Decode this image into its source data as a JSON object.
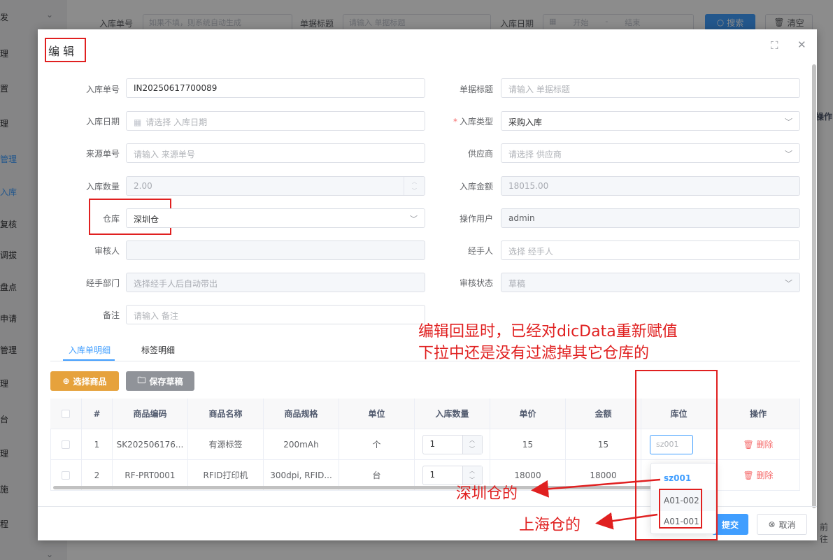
{
  "background": {
    "sidebar_items": [
      "发",
      "理",
      "置",
      "理",
      "管理",
      "入库",
      "复核",
      "调拔",
      "盘点",
      "申请",
      "管理",
      "理",
      "台",
      "理",
      "施",
      "程"
    ],
    "search_bar": {
      "label_no": "入库单号",
      "no_placeholder": "如果不填，则系统自动生成",
      "label_title": "单据标题",
      "title_placeholder": "请输入 单据标题",
      "label_date": "入库日期",
      "date_start": "开始",
      "date_sep": "-",
      "date_end": "结束",
      "search_btn": "搜索",
      "clear_btn": "清空"
    },
    "right_col": "操作",
    "right_footer": "前往"
  },
  "dialog": {
    "title": "编 辑",
    "form": {
      "inbound_no": {
        "label": "入库单号",
        "value": "IN20250617700089"
      },
      "doc_title": {
        "label": "单据标题",
        "placeholder": "请输入 单据标题"
      },
      "inbound_date": {
        "label": "入库日期",
        "placeholder": "请选择 入库日期"
      },
      "inbound_type": {
        "label": "入库类型",
        "value": "采购入库"
      },
      "source_no": {
        "label": "来源单号",
        "placeholder": "请输入 来源单号"
      },
      "supplier": {
        "label": "供应商",
        "placeholder": "请选择 供应商"
      },
      "inbound_qty": {
        "label": "入库数量",
        "value": "2.00"
      },
      "inbound_amount": {
        "label": "入库金额",
        "value": "18015.00"
      },
      "warehouse": {
        "label": "仓库",
        "value": "深圳仓"
      },
      "operator": {
        "label": "操作用户",
        "value": "admin"
      },
      "reviewer": {
        "label": "审核人",
        "value": ""
      },
      "handler": {
        "label": "经手人",
        "placeholder": "选择 经手人"
      },
      "handler_dept": {
        "label": "经手部门",
        "placeholder": "选择经手人后自动带出"
      },
      "review_status": {
        "label": "审核状态",
        "value": "草稿"
      },
      "remark": {
        "label": "备注",
        "placeholder": "请输入 备注"
      }
    },
    "tabs": [
      "入库单明细",
      "标签明细"
    ],
    "buttons": {
      "select_goods": "选择商品",
      "save_draft": "保存草稿"
    },
    "table": {
      "headers": [
        "#",
        "商品编码",
        "商品名称",
        "商品规格",
        "单位",
        "入库数量",
        "单价",
        "金额",
        "库位",
        "操作"
      ],
      "rows": [
        {
          "idx": "1",
          "code": "SK202506176...",
          "name": "有源标签",
          "spec": "200mAh",
          "unit": "个",
          "qty": "1",
          "price": "15",
          "amount": "15",
          "location": "sz001",
          "action": "删除"
        },
        {
          "idx": "2",
          "code": "RF-PRT0001",
          "name": "RFID打印机",
          "spec": "300dpi, RFID...",
          "unit": "台",
          "qty": "1",
          "price": "18000",
          "amount": "18000",
          "location": "",
          "action": "删除"
        }
      ]
    },
    "location_dropdown": [
      "sz001",
      "A01-002",
      "A01-001"
    ],
    "footer": {
      "submit": "提交",
      "cancel": "取消"
    }
  },
  "annotations": {
    "line1": "编辑回显时，已经对dicData重新赋值",
    "line2": "下拉中还是没有过滤掉其它仓库的",
    "shenzhen": "深圳仓的",
    "shanghai": "上海仓的"
  },
  "colors": {
    "primary": "#409eff",
    "warning": "#e6a23c",
    "danger": "#f56c6c",
    "annotation": "#e02020"
  }
}
